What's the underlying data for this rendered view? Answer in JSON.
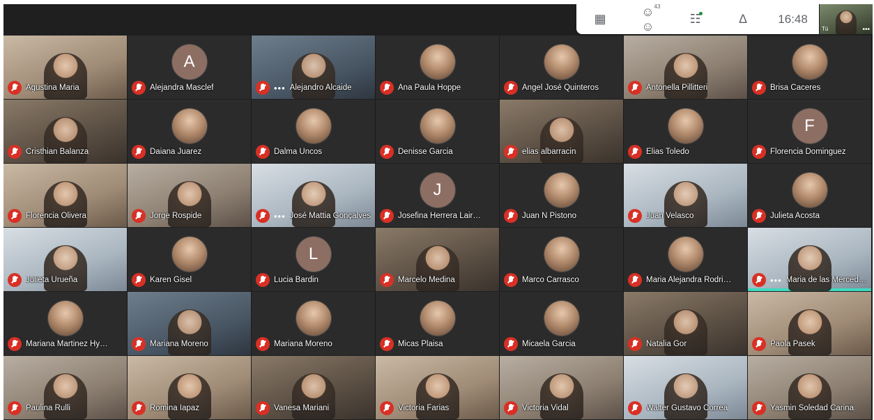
{
  "topbar": {
    "participants_count": "43",
    "clock": "16:48",
    "icons": [
      "grid-layout-icon",
      "participants-icon",
      "chat-icon",
      "activities-icon"
    ]
  },
  "self_view": {
    "label": "Tú",
    "more": "•••"
  },
  "colors": {
    "mic_muted": "#d93025",
    "active_speaker": "#3ddbc0",
    "background": "#1f1f1f"
  },
  "participants": [
    {
      "name": "Agustina Maria",
      "kind": "video",
      "style": "v4"
    },
    {
      "name": "Alejandra Masclef",
      "kind": "letter",
      "letter": "A"
    },
    {
      "name": "Alejandro Alcaide",
      "kind": "video",
      "style": "v3",
      "more": "•••"
    },
    {
      "name": "Ana Paula Hoppe",
      "kind": "avatar"
    },
    {
      "name": "Angel José Quinteros",
      "kind": "avatar"
    },
    {
      "name": "Antonella Pillitteri",
      "kind": "video",
      "style": "v2"
    },
    {
      "name": "Brisa Caceres",
      "kind": "avatar"
    },
    {
      "name": "Cristhian Balanza",
      "kind": "video",
      "style": "v1"
    },
    {
      "name": "Daiana Juarez",
      "kind": "avatar"
    },
    {
      "name": "Dalma Uncos",
      "kind": "avatar"
    },
    {
      "name": "Denisse Garcia",
      "kind": "avatar"
    },
    {
      "name": "elias albarracin",
      "kind": "video",
      "style": "v1"
    },
    {
      "name": "Elias Toledo",
      "kind": "avatar"
    },
    {
      "name": "Florencia Dominguez",
      "kind": "letter",
      "letter": "F"
    },
    {
      "name": "Florencia Olivera",
      "kind": "video",
      "style": "v4"
    },
    {
      "name": "Jorge Rospide",
      "kind": "video",
      "style": "v2"
    },
    {
      "name": "José Mattia Gonçalves",
      "kind": "video",
      "style": "v5",
      "more": "•••"
    },
    {
      "name": "Josefina Herrera Lair…",
      "kind": "letter",
      "letter": "J"
    },
    {
      "name": "Juan N Pistono",
      "kind": "avatar"
    },
    {
      "name": "Juan Velasco",
      "kind": "video",
      "style": "v5"
    },
    {
      "name": "Julieta Acosta",
      "kind": "avatar"
    },
    {
      "name": "Julieta Urueña",
      "kind": "video",
      "style": "v5"
    },
    {
      "name": "Karen Gisel",
      "kind": "avatar"
    },
    {
      "name": "Lucia Bardin",
      "kind": "letter",
      "letter": "L"
    },
    {
      "name": "Marcelo Medina",
      "kind": "video",
      "style": "v1"
    },
    {
      "name": "Marco Carrasco",
      "kind": "avatar"
    },
    {
      "name": "Maria Alejandra Rodri…",
      "kind": "avatar"
    },
    {
      "name": "Maria de las Mercede…",
      "kind": "video",
      "style": "v5",
      "more": "•••",
      "active": true
    },
    {
      "name": "Mariana Martinez Hy…",
      "kind": "avatar"
    },
    {
      "name": "Mariana Moreno",
      "kind": "video",
      "style": "v3"
    },
    {
      "name": "Mariana Moreno",
      "kind": "avatar"
    },
    {
      "name": "Micas Plaisa",
      "kind": "avatar"
    },
    {
      "name": "Micaela Garcia",
      "kind": "avatar"
    },
    {
      "name": "Natalia Gor",
      "kind": "video",
      "style": "v1"
    },
    {
      "name": "Paola Pasek",
      "kind": "video",
      "style": "v4"
    },
    {
      "name": "Paulina Rulli",
      "kind": "video",
      "style": "v2"
    },
    {
      "name": "Romina Iapaz",
      "kind": "video",
      "style": "v4"
    },
    {
      "name": "Vanesa Mariani",
      "kind": "video",
      "style": "v1"
    },
    {
      "name": "Victoria Farias",
      "kind": "video",
      "style": "v4"
    },
    {
      "name": "Victoria Vidal",
      "kind": "video",
      "style": "v2"
    },
    {
      "name": "Walter Gustavo Correa",
      "kind": "video",
      "style": "v5"
    },
    {
      "name": "Yasmin Soledad Carina",
      "kind": "video",
      "style": "v2"
    }
  ]
}
